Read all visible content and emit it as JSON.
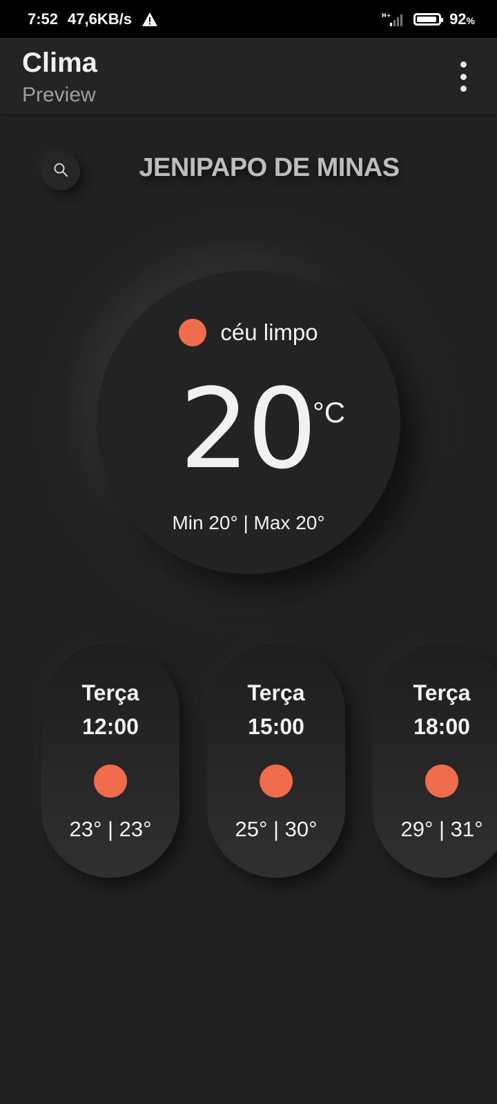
{
  "status_bar": {
    "time": "7:52",
    "speed": "47,6KB/s",
    "battery_percent": "92",
    "battery_pct_sign": "%",
    "battery_level": 0.92,
    "network": "H+"
  },
  "app_bar": {
    "title": "Clima",
    "subtitle": "Preview"
  },
  "city": "JENIPAPO DE MINAS",
  "current": {
    "condition": "céu limpo",
    "temperature": "20",
    "unit": "°C",
    "minmax": "Min 20° | Max 20°"
  },
  "forecast": [
    {
      "day": "Terça",
      "time": "12:00",
      "range": "23° | 23°"
    },
    {
      "day": "Terça",
      "time": "15:00",
      "range": "25° | 30°"
    },
    {
      "day": "Terça",
      "time": "18:00",
      "range": "29° | 31°"
    }
  ],
  "colors": {
    "accent_sun": "#ef6c4c",
    "background": "#212121",
    "status_bar": "#000000"
  },
  "icons": {
    "warning": "warning-icon",
    "signal": "signal-icon",
    "battery": "battery-icon",
    "search": "search-icon",
    "menu": "more-vert-icon",
    "condition": "sun-icon"
  }
}
